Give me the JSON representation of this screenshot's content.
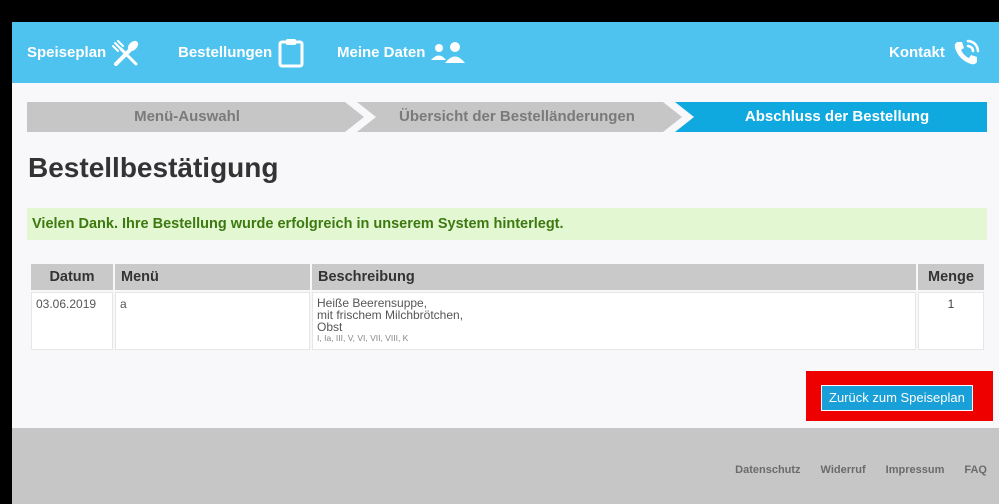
{
  "nav": {
    "items": [
      {
        "label": "Speiseplan",
        "icon": "cutlery-icon"
      },
      {
        "label": "Bestellungen",
        "icon": "clipboard-icon"
      },
      {
        "label": "Meine Daten",
        "icon": "users-icon"
      }
    ],
    "contact": {
      "label": "Kontakt",
      "icon": "phone-icon"
    }
  },
  "steps": [
    {
      "label": "Menü-Auswahl",
      "active": false
    },
    {
      "label": "Übersicht der Bestelländerungen",
      "active": false
    },
    {
      "label": "Abschluss der Bestellung",
      "active": true
    }
  ],
  "page_title": "Bestellbestätigung",
  "alert": "Vielen Dank. Ihre Bestellung wurde erfolgreich in unserem System hinterlegt.",
  "table": {
    "headers": [
      "Datum",
      "Menü",
      "Beschreibung",
      "Menge"
    ],
    "rows": [
      {
        "date": "03.06.2019",
        "menu": "a",
        "description": [
          "Heiße Beerensuppe,",
          "mit frischem Milchbrötchen,",
          "Obst"
        ],
        "allergens": "I, Ia, III, V, VI, VII, VIII, K",
        "quantity": "1"
      }
    ]
  },
  "back_button": "Zurück zum Speiseplan",
  "footer": {
    "links": [
      "Datenschutz",
      "Widerruf",
      "Impressum",
      "FAQ"
    ]
  },
  "colors": {
    "nav_bg": "#4fc3ef",
    "step_active": "#10a9df",
    "step_inactive": "#c6c6c6",
    "alert_bg": "#e3f7d2",
    "alert_text": "#3c7a0f",
    "highlight": "#ef0000",
    "button": "#1aa0d8"
  }
}
